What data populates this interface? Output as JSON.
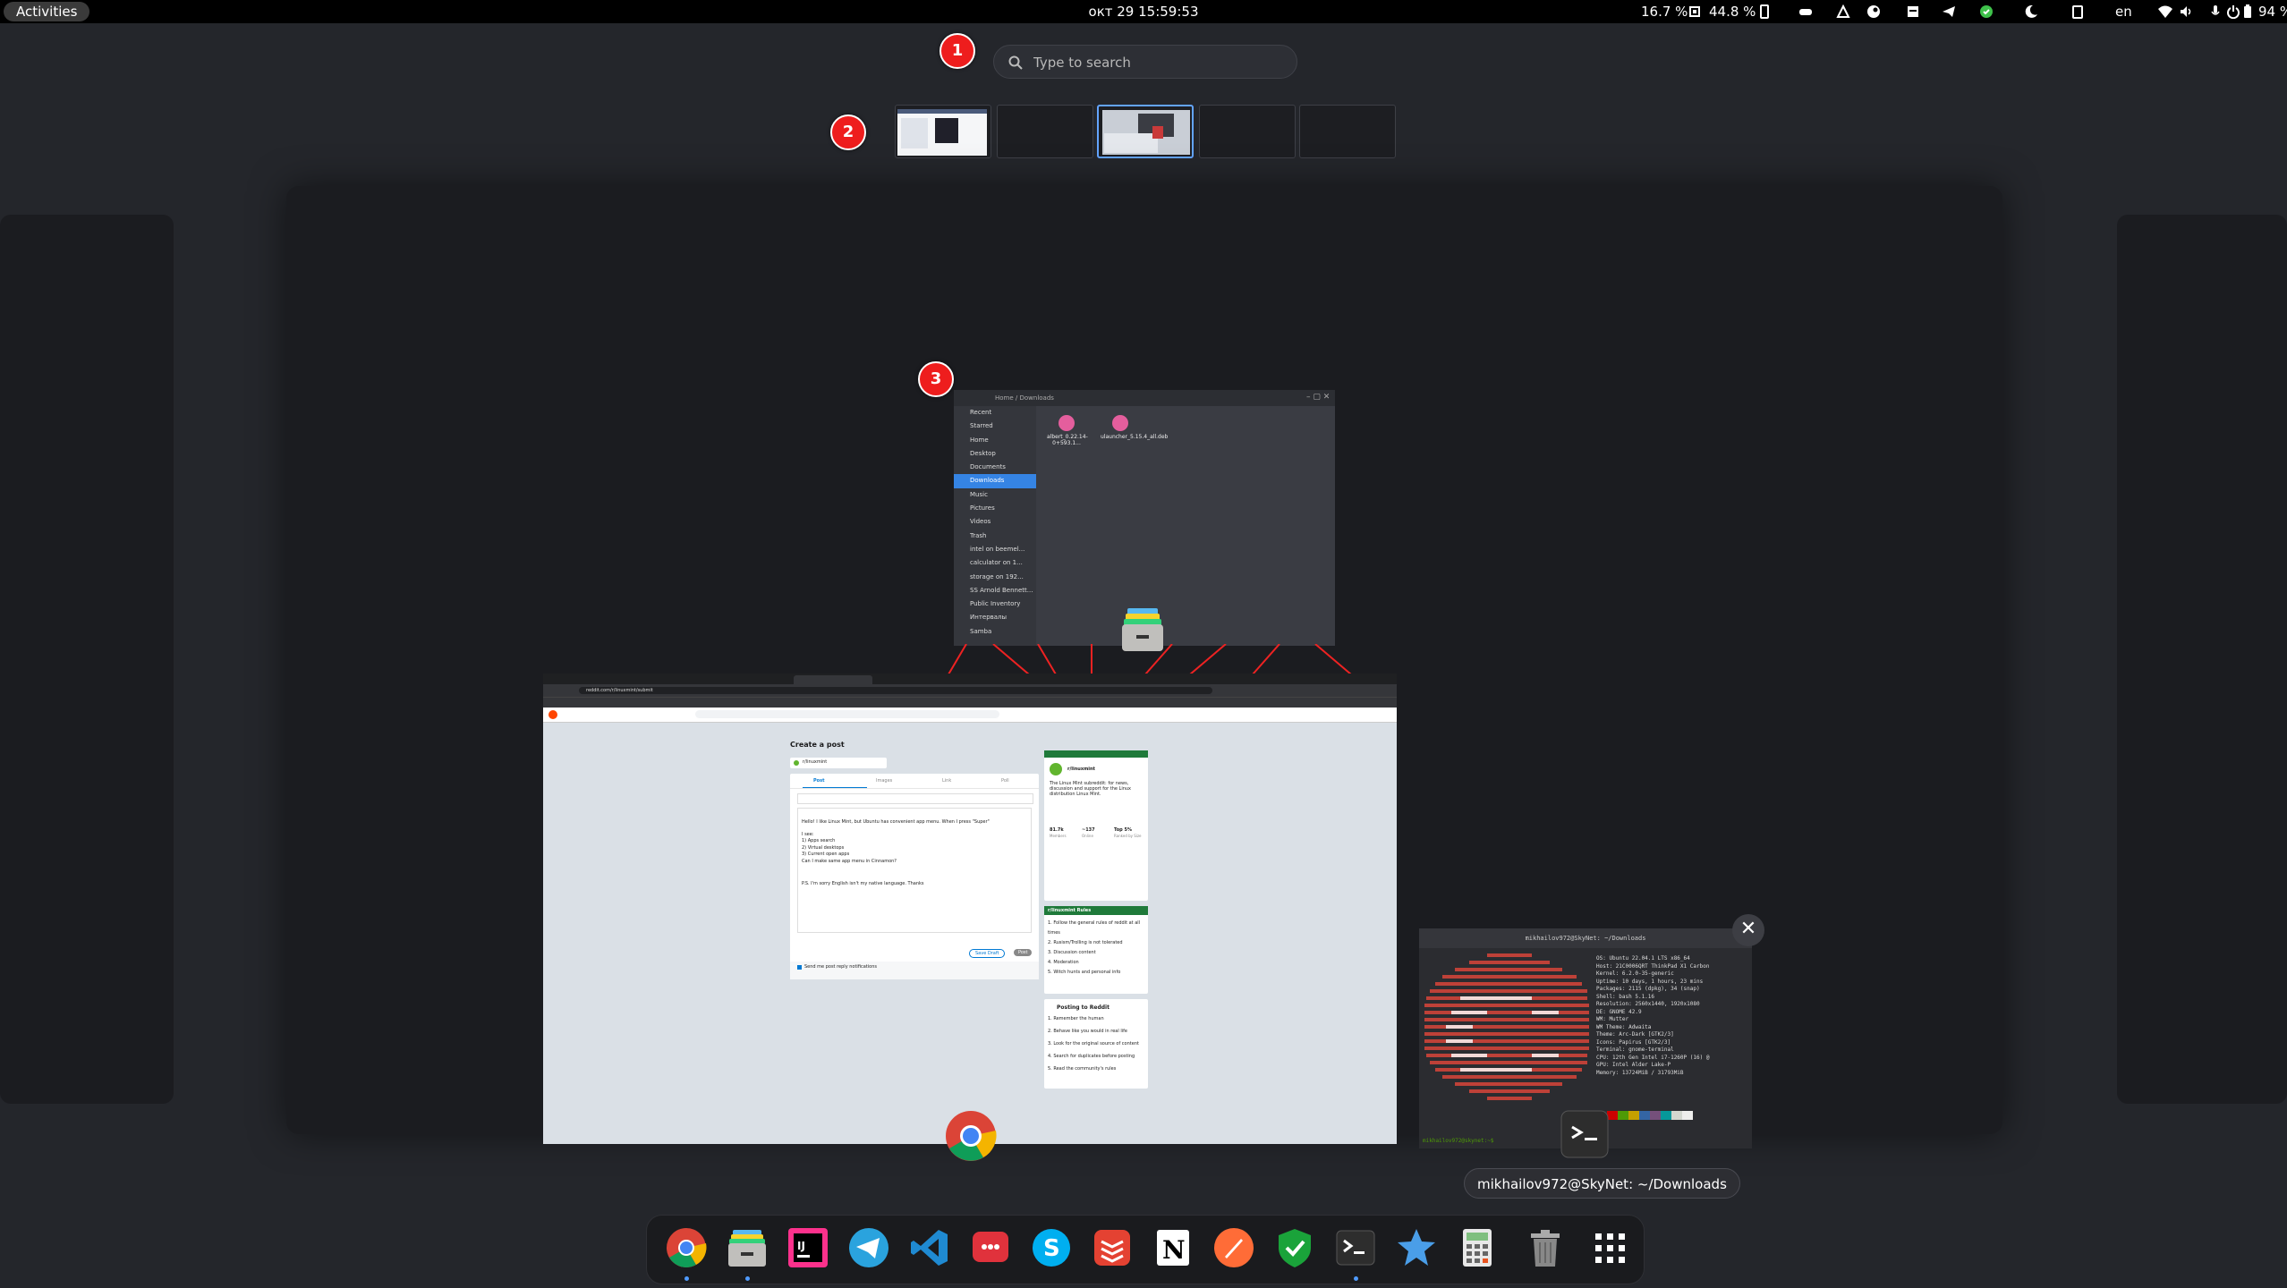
{
  "topbar": {
    "activities": "Activities",
    "clock": "окт 29  15:59:53",
    "cpu": "16.7 %",
    "mem": "44.8 %",
    "lang": "en",
    "battery": "94 %"
  },
  "overview": {
    "search_placeholder": "Type to search",
    "badges": [
      "1",
      "2",
      "3"
    ],
    "workspaces": [
      {
        "index": 1,
        "active": false
      },
      {
        "index": 2,
        "active": false
      },
      {
        "index": 3,
        "active": true
      },
      {
        "index": 4,
        "active": false
      },
      {
        "index": 5,
        "active": false
      }
    ]
  },
  "windows": {
    "files": {
      "path": "Home  /  Downloads",
      "sidebar": [
        "Recent",
        "Starred",
        "Home",
        "Desktop",
        "Documents",
        "Downloads",
        "Music",
        "Pictures",
        "Videos",
        "Trash",
        "intel on beemel...",
        "calculator on 1...",
        "storage on 192...",
        "SS Arnold Bennett...",
        "Public Inventory",
        "Интервалы",
        "Samba"
      ],
      "selected": "Downloads",
      "items": [
        "albert_0.22.14-0+593.1...",
        "ulauncher_5.15.4_all.deb"
      ]
    },
    "chrome": {
      "url": "reddit.com/r/linuxmint/submit",
      "page_title": "Create a post",
      "community": "r/linuxmint",
      "post_tabs": [
        "Post",
        "Images",
        "Link",
        "Poll"
      ],
      "body_lines": [
        "Hello! I like Linux Mint, but Ubuntu has convenient app menu. When I press \"Super\"",
        "I see:",
        "1) Apps search",
        "2) Virtual desktops",
        "3) Current open apps",
        "Can I make same app menu in Cinnamon?",
        "P.S. I'm sorry English isn't my native language. Thanks"
      ],
      "buttons": [
        "Save Draft",
        "Post"
      ],
      "notify": "Send me post reply notifications",
      "sidebar_title": "r/linuxmint",
      "sidebar_desc": "The Linux Mint subreddit: for news, discussion and support for the Linux distribution Linux Mint.",
      "stats": [
        "81.7k",
        "~137",
        "Top 5%"
      ],
      "stats_labels": [
        "Members",
        "Online",
        "Ranked by Size"
      ],
      "rules_title": "r/linuxmint Rules",
      "rules": [
        "1. Follow the general rules of reddit at all times",
        "2. Rusism/Trolling is not tolerated",
        "3. Discussion content",
        "4. Moderation",
        "5. Witch hunts and personal info"
      ],
      "posting_title": "Posting to Reddit",
      "posting_rules": [
        "1. Remember the human",
        "2. Behave like you would in real life",
        "3. Look for the original source of content",
        "4. Search for duplicates before posting",
        "5. Read the community's rules"
      ]
    },
    "terminal": {
      "title": "mikhailov972@SkyNet: ~/Downloads",
      "info": [
        "OS: Ubuntu 22.04.1 LTS x86_64",
        "Host: 21C0006QRT ThinkPad X1 Carbon",
        "Kernel: 6.2.0-35-generic",
        "Uptime: 10 days, 1 hours, 23 mins",
        "Packages: 2115 (dpkg), 34 (snap)",
        "Shell: bash 5.1.16",
        "Resolution: 2560x1440, 1920x1080",
        "DE: GNOME 42.9",
        "WM: Mutter",
        "WM Theme: Adwaita",
        "Theme: Arc-Dark [GTK2/3]",
        "Icons: Papirus [GTK2/3]",
        "Terminal: gnome-terminal",
        "CPU: 12th Gen Intel i7-1260P (16) @",
        "GPU: Intel Alder Lake-P",
        "Memory: 13724MiB / 31793MiB"
      ],
      "prompt": "mikhailov972@skynet:~$"
    }
  },
  "tooltip": "mikhailov972@SkyNet: ~/Downloads",
  "dock": [
    {
      "name": "chrome",
      "running": true
    },
    {
      "name": "files",
      "running": true
    },
    {
      "name": "intellij",
      "running": false
    },
    {
      "name": "telegram",
      "running": false
    },
    {
      "name": "vscode",
      "running": false
    },
    {
      "name": "chat",
      "running": false
    },
    {
      "name": "skype",
      "running": false
    },
    {
      "name": "todoist",
      "running": false
    },
    {
      "name": "notion",
      "running": false
    },
    {
      "name": "postman",
      "running": false
    },
    {
      "name": "shield",
      "running": false
    },
    {
      "name": "terminal",
      "running": true
    },
    {
      "name": "starred",
      "running": false
    },
    {
      "name": "calculator",
      "running": false
    },
    {
      "name": "trash",
      "running": false
    },
    {
      "name": "app-grid",
      "running": false
    }
  ],
  "colors": {
    "accent": "#3584e4",
    "badge": "#ee1d1d",
    "background": "#24262b"
  }
}
